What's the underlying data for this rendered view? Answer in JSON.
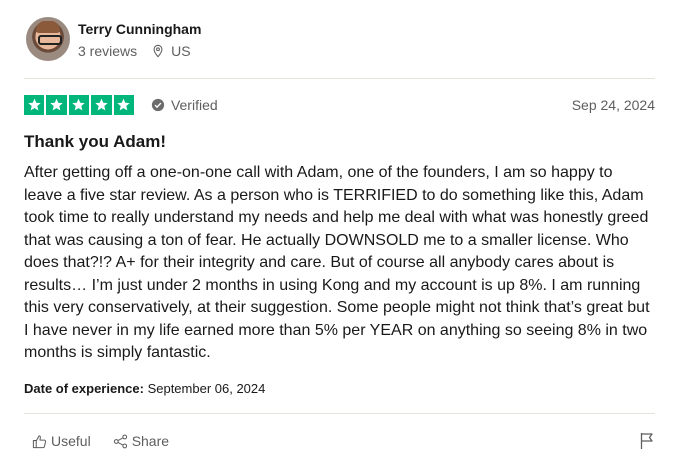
{
  "reviewer": {
    "name": "Terry Cunningham",
    "reviews": "3 reviews",
    "country": "US"
  },
  "review": {
    "rating": 5,
    "verified_label": "Verified",
    "date": "Sep 24, 2024",
    "title": "Thank you Adam!",
    "body": "After getting off a one-on-one call with Adam, one of the founders, I am so happy to leave a five star review. As a person who is TERRIFIED to do something like this, Adam took time to really understand my needs and help me deal with what was honestly greed that was causing a ton of fear. He actually DOWNSOLD me to a smaller license. Who does that?!? A+ for their integrity and care. But of course all anybody cares about is results… I’m just under 2 months in using Kong and my account is up 8%. I am running this very conservatively, at their suggestion. Some people might not think that’s great but I have never in my life earned more than 5% per YEAR on anything so seeing 8% in two months is simply fantastic.",
    "experience_label": "Date of experience:",
    "experience_date": "September 06, 2024"
  },
  "actions": {
    "useful_label": "Useful",
    "share_label": "Share"
  },
  "colors": {
    "star_green": "#00b67a",
    "muted_text": "#5e5e5e",
    "divider": "#e5e5dd"
  },
  "icons": [
    "location-icon",
    "verified-check-icon",
    "star-icon",
    "thumbs-up-icon",
    "share-icon",
    "flag-icon"
  ]
}
